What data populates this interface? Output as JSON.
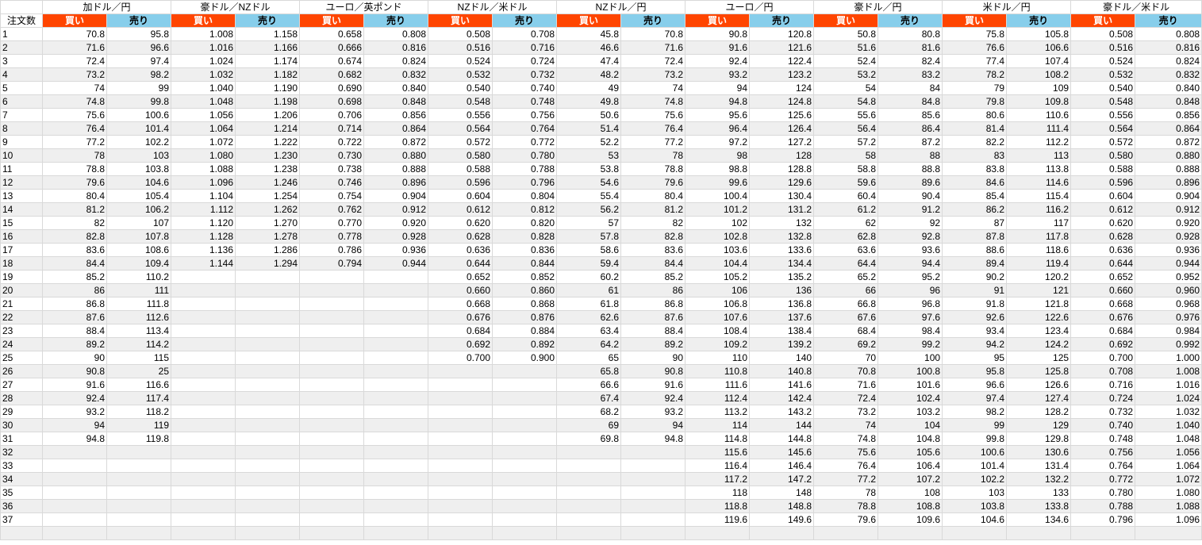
{
  "header": {
    "corner": "注文数",
    "buy_label": "買い",
    "sell_label": "売り",
    "pairs": [
      "加ドル／円",
      "豪ドル／NZドル",
      "ユーロ／英ポンド",
      "NZドル／米ドル",
      "NZドル／円",
      "ユーロ／円",
      "豪ドル／円",
      "米ドル／円",
      "豪ドル／米ドル"
    ]
  },
  "colors": {
    "buy_bg": "#ff4500",
    "sell_bg": "#87ceeb",
    "alt_row": "#efefef",
    "grid": "#d9d9d9"
  },
  "rows": [
    [
      "1",
      "70.8",
      "95.8",
      "1.008",
      "1.158",
      "0.658",
      "0.808",
      "0.508",
      "0.708",
      "45.8",
      "70.8",
      "90.8",
      "120.8",
      "50.8",
      "80.8",
      "75.8",
      "105.8",
      "0.508",
      "0.808"
    ],
    [
      "2",
      "71.6",
      "96.6",
      "1.016",
      "1.166",
      "0.666",
      "0.816",
      "0.516",
      "0.716",
      "46.6",
      "71.6",
      "91.6",
      "121.6",
      "51.6",
      "81.6",
      "76.6",
      "106.6",
      "0.516",
      "0.816"
    ],
    [
      "3",
      "72.4",
      "97.4",
      "1.024",
      "1.174",
      "0.674",
      "0.824",
      "0.524",
      "0.724",
      "47.4",
      "72.4",
      "92.4",
      "122.4",
      "52.4",
      "82.4",
      "77.4",
      "107.4",
      "0.524",
      "0.824"
    ],
    [
      "4",
      "73.2",
      "98.2",
      "1.032",
      "1.182",
      "0.682",
      "0.832",
      "0.532",
      "0.732",
      "48.2",
      "73.2",
      "93.2",
      "123.2",
      "53.2",
      "83.2",
      "78.2",
      "108.2",
      "0.532",
      "0.832"
    ],
    [
      "5",
      "74",
      "99",
      "1.040",
      "1.190",
      "0.690",
      "0.840",
      "0.540",
      "0.740",
      "49",
      "74",
      "94",
      "124",
      "54",
      "84",
      "79",
      "109",
      "0.540",
      "0.840"
    ],
    [
      "6",
      "74.8",
      "99.8",
      "1.048",
      "1.198",
      "0.698",
      "0.848",
      "0.548",
      "0.748",
      "49.8",
      "74.8",
      "94.8",
      "124.8",
      "54.8",
      "84.8",
      "79.8",
      "109.8",
      "0.548",
      "0.848"
    ],
    [
      "7",
      "75.6",
      "100.6",
      "1.056",
      "1.206",
      "0.706",
      "0.856",
      "0.556",
      "0.756",
      "50.6",
      "75.6",
      "95.6",
      "125.6",
      "55.6",
      "85.6",
      "80.6",
      "110.6",
      "0.556",
      "0.856"
    ],
    [
      "8",
      "76.4",
      "101.4",
      "1.064",
      "1.214",
      "0.714",
      "0.864",
      "0.564",
      "0.764",
      "51.4",
      "76.4",
      "96.4",
      "126.4",
      "56.4",
      "86.4",
      "81.4",
      "111.4",
      "0.564",
      "0.864"
    ],
    [
      "9",
      "77.2",
      "102.2",
      "1.072",
      "1.222",
      "0.722",
      "0.872",
      "0.572",
      "0.772",
      "52.2",
      "77.2",
      "97.2",
      "127.2",
      "57.2",
      "87.2",
      "82.2",
      "112.2",
      "0.572",
      "0.872"
    ],
    [
      "10",
      "78",
      "103",
      "1.080",
      "1.230",
      "0.730",
      "0.880",
      "0.580",
      "0.780",
      "53",
      "78",
      "98",
      "128",
      "58",
      "88",
      "83",
      "113",
      "0.580",
      "0.880"
    ],
    [
      "11",
      "78.8",
      "103.8",
      "1.088",
      "1.238",
      "0.738",
      "0.888",
      "0.588",
      "0.788",
      "53.8",
      "78.8",
      "98.8",
      "128.8",
      "58.8",
      "88.8",
      "83.8",
      "113.8",
      "0.588",
      "0.888"
    ],
    [
      "12",
      "79.6",
      "104.6",
      "1.096",
      "1.246",
      "0.746",
      "0.896",
      "0.596",
      "0.796",
      "54.6",
      "79.6",
      "99.6",
      "129.6",
      "59.6",
      "89.6",
      "84.6",
      "114.6",
      "0.596",
      "0.896"
    ],
    [
      "13",
      "80.4",
      "105.4",
      "1.104",
      "1.254",
      "0.754",
      "0.904",
      "0.604",
      "0.804",
      "55.4",
      "80.4",
      "100.4",
      "130.4",
      "60.4",
      "90.4",
      "85.4",
      "115.4",
      "0.604",
      "0.904"
    ],
    [
      "14",
      "81.2",
      "106.2",
      "1.112",
      "1.262",
      "0.762",
      "0.912",
      "0.612",
      "0.812",
      "56.2",
      "81.2",
      "101.2",
      "131.2",
      "61.2",
      "91.2",
      "86.2",
      "116.2",
      "0.612",
      "0.912"
    ],
    [
      "15",
      "82",
      "107",
      "1.120",
      "1.270",
      "0.770",
      "0.920",
      "0.620",
      "0.820",
      "57",
      "82",
      "102",
      "132",
      "62",
      "92",
      "87",
      "117",
      "0.620",
      "0.920"
    ],
    [
      "16",
      "82.8",
      "107.8",
      "1.128",
      "1.278",
      "0.778",
      "0.928",
      "0.628",
      "0.828",
      "57.8",
      "82.8",
      "102.8",
      "132.8",
      "62.8",
      "92.8",
      "87.8",
      "117.8",
      "0.628",
      "0.928"
    ],
    [
      "17",
      "83.6",
      "108.6",
      "1.136",
      "1.286",
      "0.786",
      "0.936",
      "0.636",
      "0.836",
      "58.6",
      "83.6",
      "103.6",
      "133.6",
      "63.6",
      "93.6",
      "88.6",
      "118.6",
      "0.636",
      "0.936"
    ],
    [
      "18",
      "84.4",
      "109.4",
      "1.144",
      "1.294",
      "0.794",
      "0.944",
      "0.644",
      "0.844",
      "59.4",
      "84.4",
      "104.4",
      "134.4",
      "64.4",
      "94.4",
      "89.4",
      "119.4",
      "0.644",
      "0.944"
    ],
    [
      "19",
      "85.2",
      "110.2",
      "",
      "",
      "",
      "",
      "0.652",
      "0.852",
      "60.2",
      "85.2",
      "105.2",
      "135.2",
      "65.2",
      "95.2",
      "90.2",
      "120.2",
      "0.652",
      "0.952"
    ],
    [
      "20",
      "86",
      "111",
      "",
      "",
      "",
      "",
      "0.660",
      "0.860",
      "61",
      "86",
      "106",
      "136",
      "66",
      "96",
      "91",
      "121",
      "0.660",
      "0.960"
    ],
    [
      "21",
      "86.8",
      "111.8",
      "",
      "",
      "",
      "",
      "0.668",
      "0.868",
      "61.8",
      "86.8",
      "106.8",
      "136.8",
      "66.8",
      "96.8",
      "91.8",
      "121.8",
      "0.668",
      "0.968"
    ],
    [
      "22",
      "87.6",
      "112.6",
      "",
      "",
      "",
      "",
      "0.676",
      "0.876",
      "62.6",
      "87.6",
      "107.6",
      "137.6",
      "67.6",
      "97.6",
      "92.6",
      "122.6",
      "0.676",
      "0.976"
    ],
    [
      "23",
      "88.4",
      "113.4",
      "",
      "",
      "",
      "",
      "0.684",
      "0.884",
      "63.4",
      "88.4",
      "108.4",
      "138.4",
      "68.4",
      "98.4",
      "93.4",
      "123.4",
      "0.684",
      "0.984"
    ],
    [
      "24",
      "89.2",
      "114.2",
      "",
      "",
      "",
      "",
      "0.692",
      "0.892",
      "64.2",
      "89.2",
      "109.2",
      "139.2",
      "69.2",
      "99.2",
      "94.2",
      "124.2",
      "0.692",
      "0.992"
    ],
    [
      "25",
      "90",
      "115",
      "",
      "",
      "",
      "",
      "0.700",
      "0.900",
      "65",
      "90",
      "110",
      "140",
      "70",
      "100",
      "95",
      "125",
      "0.700",
      "1.000"
    ],
    [
      "26",
      "90.8",
      "25",
      "",
      "",
      "",
      "",
      "",
      "",
      "65.8",
      "90.8",
      "110.8",
      "140.8",
      "70.8",
      "100.8",
      "95.8",
      "125.8",
      "0.708",
      "1.008"
    ],
    [
      "27",
      "91.6",
      "116.6",
      "",
      "",
      "",
      "",
      "",
      "",
      "66.6",
      "91.6",
      "111.6",
      "141.6",
      "71.6",
      "101.6",
      "96.6",
      "126.6",
      "0.716",
      "1.016"
    ],
    [
      "28",
      "92.4",
      "117.4",
      "",
      "",
      "",
      "",
      "",
      "",
      "67.4",
      "92.4",
      "112.4",
      "142.4",
      "72.4",
      "102.4",
      "97.4",
      "127.4",
      "0.724",
      "1.024"
    ],
    [
      "29",
      "93.2",
      "118.2",
      "",
      "",
      "",
      "",
      "",
      "",
      "68.2",
      "93.2",
      "113.2",
      "143.2",
      "73.2",
      "103.2",
      "98.2",
      "128.2",
      "0.732",
      "1.032"
    ],
    [
      "30",
      "94",
      "119",
      "",
      "",
      "",
      "",
      "",
      "",
      "69",
      "94",
      "114",
      "144",
      "74",
      "104",
      "99",
      "129",
      "0.740",
      "1.040"
    ],
    [
      "31",
      "94.8",
      "119.8",
      "",
      "",
      "",
      "",
      "",
      "",
      "69.8",
      "94.8",
      "114.8",
      "144.8",
      "74.8",
      "104.8",
      "99.8",
      "129.8",
      "0.748",
      "1.048"
    ],
    [
      "32",
      "",
      "",
      "",
      "",
      "",
      "",
      "",
      "",
      "",
      "",
      "115.6",
      "145.6",
      "75.6",
      "105.6",
      "100.6",
      "130.6",
      "0.756",
      "1.056"
    ],
    [
      "33",
      "",
      "",
      "",
      "",
      "",
      "",
      "",
      "",
      "",
      "",
      "116.4",
      "146.4",
      "76.4",
      "106.4",
      "101.4",
      "131.4",
      "0.764",
      "1.064"
    ],
    [
      "34",
      "",
      "",
      "",
      "",
      "",
      "",
      "",
      "",
      "",
      "",
      "117.2",
      "147.2",
      "77.2",
      "107.2",
      "102.2",
      "132.2",
      "0.772",
      "1.072"
    ],
    [
      "35",
      "",
      "",
      "",
      "",
      "",
      "",
      "",
      "",
      "",
      "",
      "118",
      "148",
      "78",
      "108",
      "103",
      "133",
      "0.780",
      "1.080"
    ],
    [
      "36",
      "",
      "",
      "",
      "",
      "",
      "",
      "",
      "",
      "",
      "",
      "118.8",
      "148.8",
      "78.8",
      "108.8",
      "103.8",
      "133.8",
      "0.788",
      "1.088"
    ],
    [
      "37",
      "",
      "",
      "",
      "",
      "",
      "",
      "",
      "",
      "",
      "",
      "119.6",
      "149.6",
      "79.6",
      "109.6",
      "104.6",
      "134.6",
      "0.796",
      "1.096"
    ]
  ]
}
